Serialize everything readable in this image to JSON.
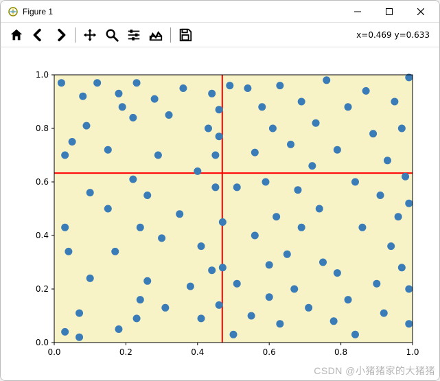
{
  "window": {
    "title": "Figure 1"
  },
  "toolbar": {
    "home": "Home",
    "back": "Back",
    "forward": "Forward",
    "pan": "Pan",
    "zoom": "Zoom",
    "config": "Configure",
    "edit": "Edit",
    "save": "Save",
    "coord_text": "x=0.469  y=0.633"
  },
  "watermark": "CSDN @小猪猪家的大猪猪",
  "chart_data": {
    "type": "scatter",
    "title": "",
    "xlabel": "",
    "ylabel": "",
    "xlim": [
      0.0,
      1.0
    ],
    "ylim": [
      0.0,
      1.0
    ],
    "xticks": [
      0.0,
      0.2,
      0.4,
      0.6,
      0.8,
      1.0
    ],
    "yticks": [
      0.0,
      0.2,
      0.4,
      0.6,
      0.8,
      1.0
    ],
    "background": "#f8f3c7",
    "crosshair": {
      "x": 0.469,
      "y": 0.633,
      "color": "#ff0000"
    },
    "marker": {
      "color": "#3a7cb8",
      "size": 5.5
    },
    "x": [
      0.02,
      0.03,
      0.03,
      0.04,
      0.05,
      0.07,
      0.03,
      0.08,
      0.09,
      0.07,
      0.1,
      0.1,
      0.12,
      0.15,
      0.15,
      0.17,
      0.18,
      0.18,
      0.19,
      0.22,
      0.22,
      0.23,
      0.23,
      0.24,
      0.24,
      0.26,
      0.26,
      0.28,
      0.29,
      0.3,
      0.31,
      0.32,
      0.35,
      0.36,
      0.38,
      0.4,
      0.41,
      0.41,
      0.43,
      0.44,
      0.44,
      0.45,
      0.45,
      0.46,
      0.46,
      0.46,
      0.47,
      0.47,
      0.49,
      0.5,
      0.51,
      0.51,
      0.54,
      0.55,
      0.56,
      0.56,
      0.58,
      0.59,
      0.6,
      0.6,
      0.61,
      0.62,
      0.63,
      0.63,
      0.65,
      0.66,
      0.67,
      0.68,
      0.69,
      0.69,
      0.71,
      0.72,
      0.73,
      0.74,
      0.75,
      0.76,
      0.78,
      0.79,
      0.79,
      0.82,
      0.82,
      0.84,
      0.84,
      0.86,
      0.87,
      0.89,
      0.9,
      0.91,
      0.92,
      0.93,
      0.94,
      0.95,
      0.96,
      0.97,
      0.97,
      0.98,
      0.99,
      0.99,
      0.99,
      0.99
    ],
    "y": [
      0.97,
      0.7,
      0.43,
      0.34,
      0.75,
      0.11,
      0.04,
      0.92,
      0.81,
      0.02,
      0.56,
      0.24,
      0.97,
      0.5,
      0.72,
      0.34,
      0.93,
      0.05,
      0.88,
      0.84,
      0.61,
      0.97,
      0.09,
      0.43,
      0.16,
      0.55,
      0.23,
      0.91,
      0.7,
      0.39,
      0.13,
      0.85,
      0.48,
      0.95,
      0.21,
      0.64,
      0.09,
      0.36,
      0.8,
      0.93,
      0.27,
      0.7,
      0.58,
      0.87,
      0.77,
      0.14,
      0.28,
      0.45,
      0.96,
      0.03,
      0.22,
      0.58,
      0.95,
      0.1,
      0.71,
      0.4,
      0.88,
      0.6,
      0.29,
      0.17,
      0.8,
      0.47,
      0.96,
      0.07,
      0.33,
      0.74,
      0.2,
      0.57,
      0.9,
      0.43,
      0.13,
      0.66,
      0.82,
      0.5,
      0.3,
      0.98,
      0.08,
      0.26,
      0.72,
      0.88,
      0.16,
      0.6,
      0.03,
      0.43,
      0.94,
      0.78,
      0.22,
      0.55,
      0.11,
      0.68,
      0.36,
      0.9,
      0.47,
      0.8,
      0.28,
      0.62,
      0.99,
      0.2,
      0.52,
      0.07
    ]
  }
}
